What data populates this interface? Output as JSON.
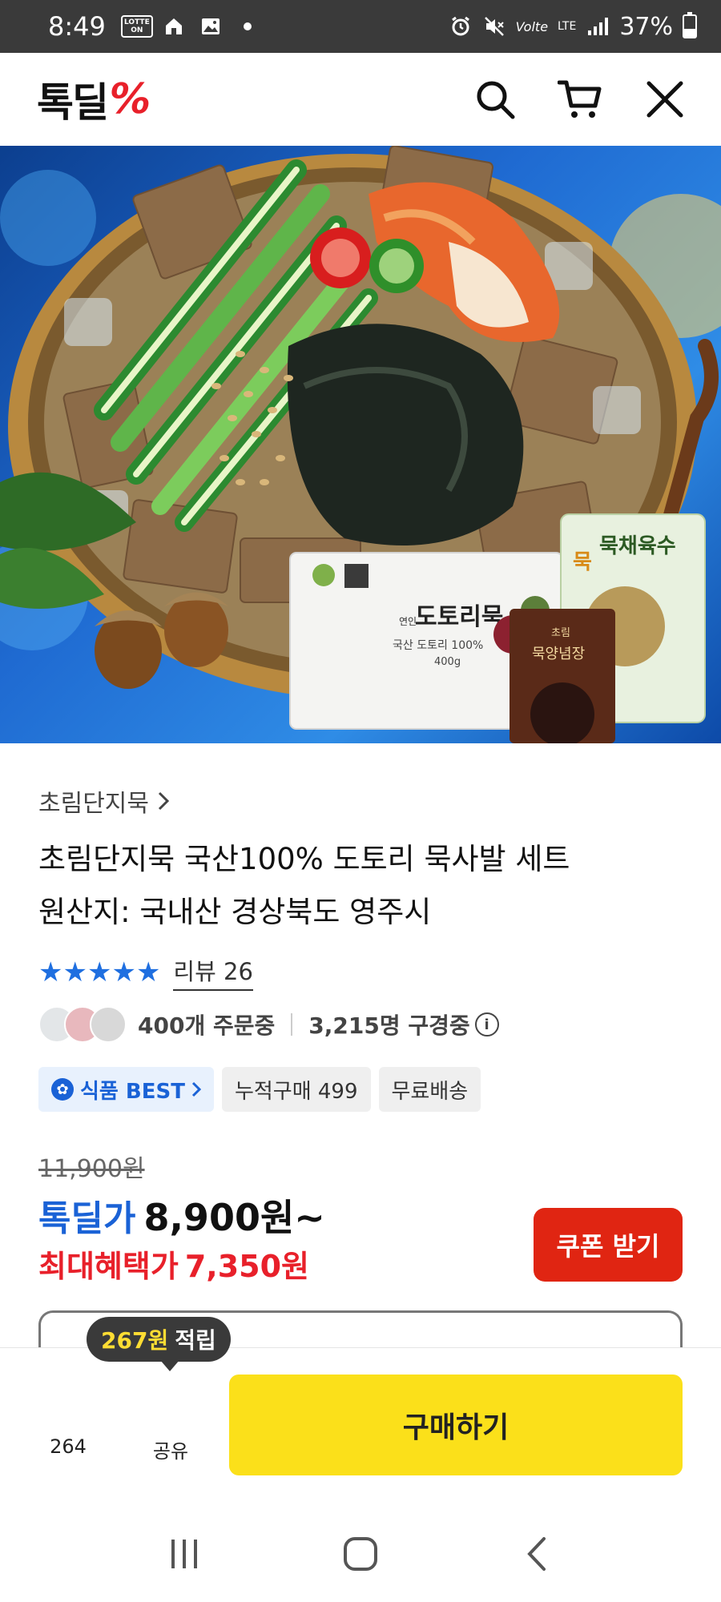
{
  "status_bar": {
    "time": "8:49",
    "app_badge": "LOTTE ON",
    "volte": "Volte",
    "network": "LTE",
    "battery": "37%",
    "battery_level": 0.37
  },
  "header": {
    "logo_text": "톡딜",
    "logo_mark": "%",
    "icons": [
      "search-icon",
      "cart-icon",
      "close-icon"
    ]
  },
  "hero": {
    "package_brand": "연인",
    "package_product": "도토리묵",
    "package_sub": "국산 도토리 100%",
    "package_weight": "400g",
    "sauce_label_top": "초림",
    "sauce_label": "묵양념장",
    "broth_label": "묵채육수",
    "broth_mark": "묵",
    "carousel_total": 6,
    "carousel_active": 0
  },
  "product": {
    "category": "초림단지묵",
    "title_line1": "초림단지묵 국산100% 도토리 묵사발 세트",
    "title_line2": "원산지: 국내산 경상북도 영주시",
    "rating_stars": 5,
    "review_label": "리뷰 26",
    "orders": "400개 주문중",
    "viewers": "3,215명 구경중",
    "tags": {
      "best": "식품 BEST",
      "cumulative": "누적구매 499",
      "shipping": "무료배송"
    },
    "price_original": "11,900원",
    "price_label": "톡딜가",
    "price_value": "8,900원~",
    "max_label": "최대혜택가",
    "max_value": "7,350원",
    "coupon_button": "쿠폰 받기"
  },
  "bottom_bar": {
    "reward_amount": "267원",
    "reward_suffix": "적립",
    "likes": "264",
    "share": "공유",
    "buy": "구매하기"
  },
  "colors": {
    "accent_blue": "#1a62d6",
    "accent_red": "#e02512",
    "buy_yellow": "#fbe01a"
  }
}
